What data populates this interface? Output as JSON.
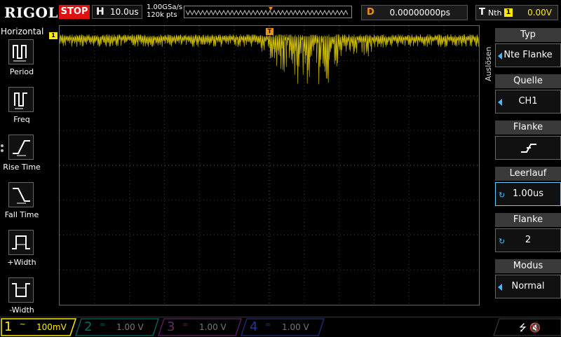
{
  "header": {
    "brand": "RIGOL",
    "run_status": "STOP",
    "horizontal": {
      "label": "H",
      "value": "10.0us"
    },
    "sample_rate": "1.00GSa/s",
    "memory_depth": "120k pts",
    "delay": {
      "label": "D",
      "value": "0.00000000ps"
    },
    "trigger": {
      "label": "T",
      "mode": "Nth",
      "channel": "1",
      "level": "0.00V"
    }
  },
  "left_menu": {
    "title": "Horizontal",
    "items": [
      {
        "label": "Period",
        "icon": "period-icon"
      },
      {
        "label": "Freq",
        "icon": "freq-icon"
      },
      {
        "label": "Rise Time",
        "icon": "rise-time-icon"
      },
      {
        "label": "Fall Time",
        "icon": "fall-time-icon"
      },
      {
        "label": "+Width",
        "icon": "positive-width-icon"
      },
      {
        "label": "-Width",
        "icon": "negative-width-icon"
      }
    ]
  },
  "right_menu": {
    "title": "Auslösen",
    "items": [
      {
        "header": "Typ",
        "value": "Nte Flanke"
      },
      {
        "header": "Quelle",
        "value": "CH1"
      },
      {
        "header": "Flanke",
        "value": ""
      },
      {
        "header": "Leerlauf",
        "value": "1.00us"
      },
      {
        "header": "Flanke",
        "value": "2"
      },
      {
        "header": "Modus",
        "value": "Normal"
      }
    ]
  },
  "channels": [
    {
      "num": "1",
      "coupling": "~",
      "scale": "100mV",
      "color": "#ffea00",
      "active": true
    },
    {
      "num": "2",
      "coupling": "=",
      "scale": "1.00 V",
      "color": "#00c8c8",
      "active": false
    },
    {
      "num": "3",
      "coupling": "=",
      "scale": "1.00 V",
      "color": "#d040d0",
      "active": false
    },
    {
      "num": "4",
      "coupling": "=",
      "scale": "1.00 V",
      "color": "#3a7aff",
      "active": false
    }
  ],
  "markers": {
    "channel": "1",
    "trigger": "T"
  },
  "colors": {
    "ch1": "#ffea00",
    "trigger": "#f29400",
    "accent": "#44bbff"
  }
}
